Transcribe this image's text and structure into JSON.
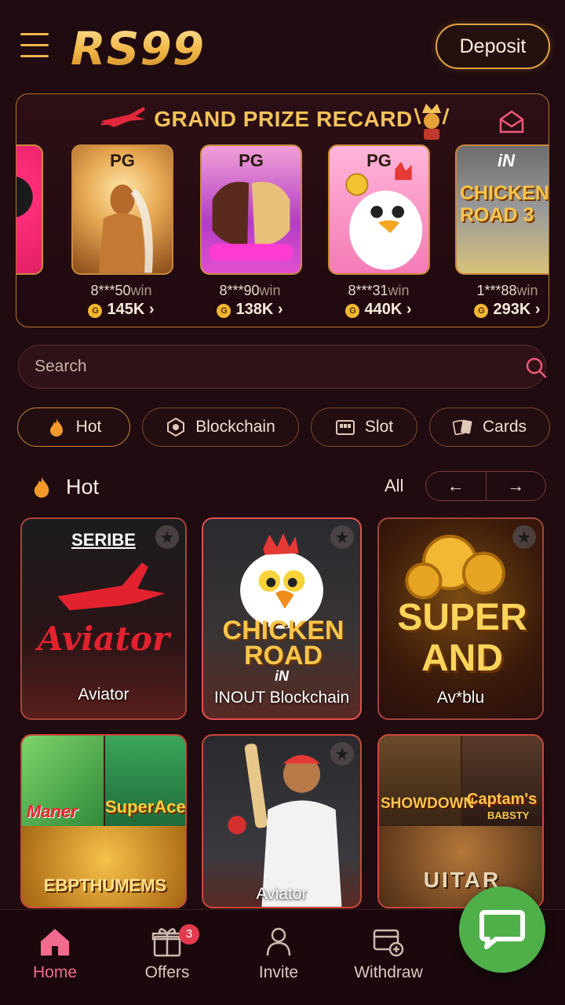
{
  "header": {
    "logo": "RS99",
    "deposit_label": "Deposit"
  },
  "prize": {
    "title": "GRAND PRIZE RECARD",
    "cards": [
      {
        "brand": "PG",
        "user": "8***50",
        "win_label": "win",
        "amount": "145K"
      },
      {
        "brand": "PG",
        "user": "8***90",
        "win_label": "win",
        "amount": "138K"
      },
      {
        "brand": "PG",
        "user": "8***31",
        "win_label": "win",
        "amount": "440K"
      },
      {
        "brand": "iN",
        "user": "1***88",
        "win_label": "win",
        "amount": "293K",
        "art_text": "CHICKEN ROAD 3"
      }
    ]
  },
  "search": {
    "placeholder": "Search"
  },
  "categories": [
    "Hot",
    "Blockchain",
    "Slot",
    "Cards"
  ],
  "section": {
    "title": "Hot",
    "all_label": "All",
    "prev": "←",
    "next": "→"
  },
  "games": [
    {
      "name": "Aviator",
      "brand": "SERIBE",
      "art_text": "Aviator"
    },
    {
      "name": "INOUT Blockchain",
      "brand": "iN",
      "art_text": "CHICKEN ROAD"
    },
    {
      "name": "Av*blu",
      "art_text": "SUPER AND"
    },
    {
      "name": "",
      "art_text_1": "Maner",
      "art_text_2": "SuperAce",
      "art_text_3": "EBPTHUMEMS"
    },
    {
      "name": "Aviator"
    },
    {
      "name": "",
      "art_text_1": "SHOWDOWN",
      "art_text_2": "Captam's",
      "art_text_3": "BABSTY",
      "art_text_4": "UITAR"
    }
  ],
  "nav": [
    {
      "label": "Home",
      "active": true
    },
    {
      "label": "Offers",
      "badge": "3"
    },
    {
      "label": "Invite"
    },
    {
      "label": "Withdraw"
    }
  ],
  "colors": {
    "background": "#1f0b10",
    "gold": "#f0b84b",
    "active_nav": "#f26a8d",
    "chat": "#4fb04a"
  }
}
